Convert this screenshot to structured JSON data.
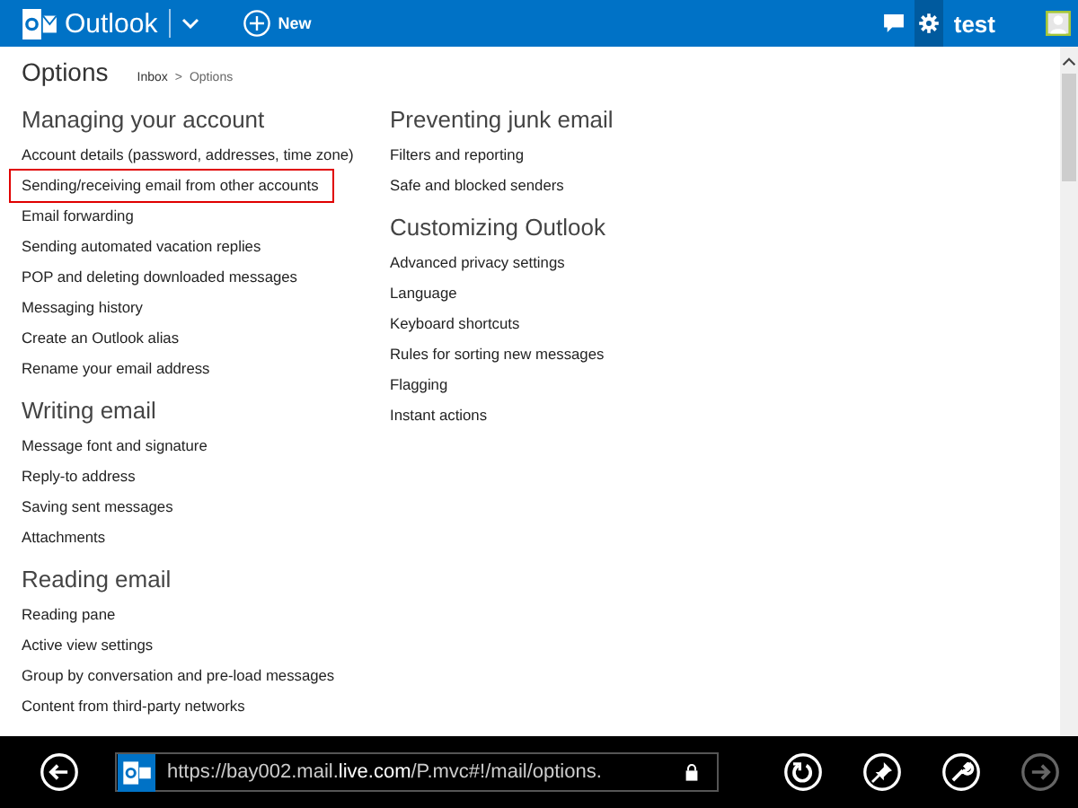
{
  "topbar": {
    "app_name": "Outlook",
    "new_label": "New",
    "user": "test"
  },
  "page": {
    "title": "Options",
    "breadcrumb": [
      "Inbox",
      ">",
      "Options"
    ]
  },
  "columns": [
    {
      "sections": [
        {
          "heading": "Managing your account",
          "items": [
            {
              "label": "Account details (password, addresses, time zone)",
              "selected": false
            },
            {
              "label": "Sending/receiving email from other accounts",
              "selected": true
            },
            {
              "label": "Email forwarding",
              "selected": false
            },
            {
              "label": "Sending automated vacation replies",
              "selected": false
            },
            {
              "label": "POP and deleting downloaded messages",
              "selected": false
            },
            {
              "label": "Messaging history",
              "selected": false
            },
            {
              "label": "Create an Outlook alias",
              "selected": false
            },
            {
              "label": "Rename your email address",
              "selected": false
            }
          ]
        },
        {
          "heading": "Writing email",
          "items": [
            {
              "label": "Message font and signature",
              "selected": false
            },
            {
              "label": "Reply-to address",
              "selected": false
            },
            {
              "label": "Saving sent messages",
              "selected": false
            },
            {
              "label": "Attachments",
              "selected": false
            }
          ]
        },
        {
          "heading": "Reading email",
          "items": [
            {
              "label": "Reading pane",
              "selected": false
            },
            {
              "label": "Active view settings",
              "selected": false
            },
            {
              "label": "Group by conversation and pre-load messages",
              "selected": false
            },
            {
              "label": "Content from third-party networks",
              "selected": false
            }
          ]
        }
      ]
    },
    {
      "sections": [
        {
          "heading": "Preventing junk email",
          "items": [
            {
              "label": "Filters and reporting",
              "selected": false
            },
            {
              "label": "Safe and blocked senders",
              "selected": false
            }
          ]
        },
        {
          "heading": "Customizing Outlook",
          "items": [
            {
              "label": "Advanced privacy settings",
              "selected": false
            },
            {
              "label": "Language",
              "selected": false
            },
            {
              "label": "Keyboard shortcuts",
              "selected": false
            },
            {
              "label": "Rules for sorting new messages",
              "selected": false
            },
            {
              "label": "Flagging",
              "selected": false
            },
            {
              "label": "Instant actions",
              "selected": false
            }
          ]
        }
      ]
    }
  ],
  "browser_bar": {
    "url": "https://bay002.mail.**live.com**/P.mvc#!/mail/options.",
    "forward_disabled": true
  }
}
